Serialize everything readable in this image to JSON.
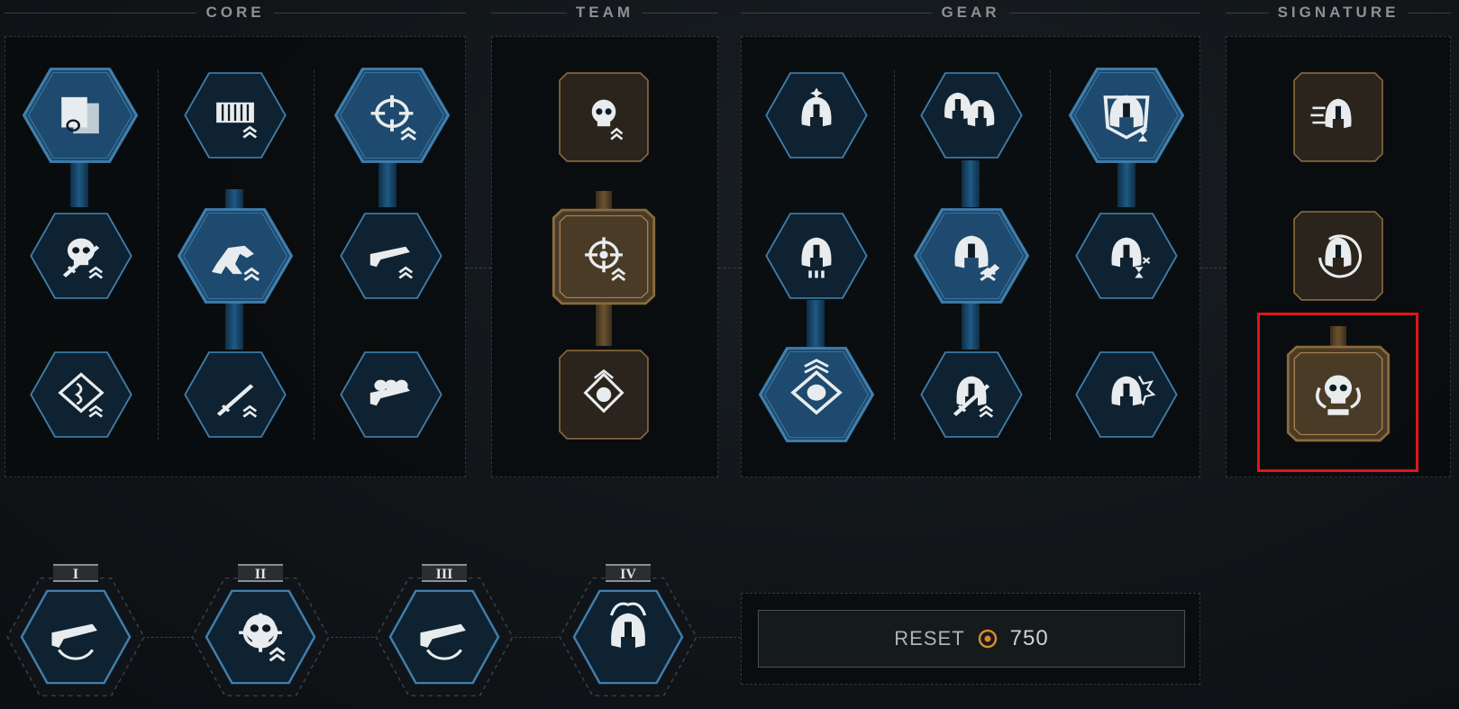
{
  "sections": {
    "core": "CORE",
    "team": "TEAM",
    "gear": "GEAR",
    "signature": "SIGNATURE"
  },
  "core_perks": [
    {
      "icon": "swap-card-icon",
      "state": "active"
    },
    {
      "icon": "ammo-crate-icon",
      "state": "inactive"
    },
    {
      "icon": "crosshair-sweep-icon",
      "state": "active"
    },
    {
      "icon": "skull-blade-icon",
      "state": "inactive"
    },
    {
      "icon": "runner-boost-icon",
      "state": "active"
    },
    {
      "icon": "pistol-boost-icon",
      "state": "inactive"
    },
    {
      "icon": "dna-diamond-icon",
      "state": "inactive"
    },
    {
      "icon": "sword-upgrade-icon",
      "state": "inactive"
    },
    {
      "icon": "skulls-rifle-icon",
      "state": "inactive"
    }
  ],
  "team_perks": [
    {
      "icon": "skull-target-icon",
      "state": "inactive"
    },
    {
      "icon": "crosshair-focus-icon",
      "state": "active"
    },
    {
      "icon": "skull-diamond-rank-icon",
      "state": "inactive"
    }
  ],
  "gear_perks": [
    {
      "icon": "helmet-sparkle-icon",
      "state": "inactive"
    },
    {
      "icon": "twin-helmet-icon",
      "state": "inactive"
    },
    {
      "icon": "helmet-hourglass-shield-icon",
      "state": "active"
    },
    {
      "icon": "helmet-ammo-icon",
      "state": "inactive"
    },
    {
      "icon": "helmet-bullet-icon",
      "state": "active"
    },
    {
      "icon": "helmet-hourglass-icon",
      "state": "inactive"
    },
    {
      "icon": "skull-diamond-icon",
      "state": "active"
    },
    {
      "icon": "helmet-sword-icon",
      "state": "inactive"
    },
    {
      "icon": "helmet-explosion-icon",
      "state": "inactive"
    }
  ],
  "signature_perks": [
    {
      "icon": "helmet-dash-icon",
      "state": "inactive"
    },
    {
      "icon": "helmet-cycle-icon",
      "state": "inactive"
    },
    {
      "icon": "skull-horns-icon",
      "state": "active",
      "highlighted": true
    }
  ],
  "tiers": [
    {
      "label": "I",
      "icon": "pistol-swap-icon"
    },
    {
      "label": "II",
      "icon": "skull-crosshair-icon"
    },
    {
      "label": "III",
      "icon": "rifle-swap-icon"
    },
    {
      "label": "IV",
      "icon": "flame-helmet-icon"
    }
  ],
  "reset": {
    "label": "RESET",
    "cost": "750",
    "currency_icon": "coin-icon"
  },
  "colors": {
    "active_blue": "#1d4a6e",
    "inactive_blue": "#0f2231",
    "blue_border": "#3f7fae",
    "gold_border": "#8a6a3c",
    "gold_fill": "#2a241c",
    "gold_active_fill": "#4a3b27",
    "selection": "#e0151b",
    "coin": "#d88a2a"
  }
}
